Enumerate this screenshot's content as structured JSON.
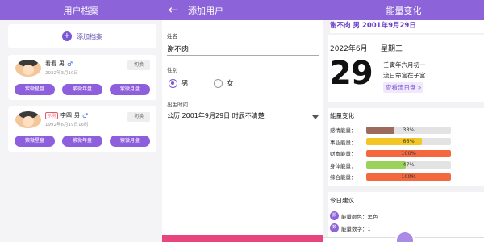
{
  "screen1": {
    "title": "用户档案",
    "add_label": "添加档案",
    "profiles": [
      {
        "name": "看看",
        "gender": "男",
        "gender_symbol": "♂",
        "tag": "",
        "date": "2022年3月10日",
        "switch": "切换",
        "buttons": [
          "紫微星盘",
          "紫微年盘",
          "紫微月盘"
        ]
      },
      {
        "name": "李四",
        "gender": "男",
        "gender_symbol": "♂",
        "tag": "示例",
        "date": "1992年6月19日16时",
        "switch": "切换",
        "buttons": [
          "紫微星盘",
          "紫微年盘",
          "紫微月盘"
        ]
      }
    ]
  },
  "screen2": {
    "title": "添加用户",
    "back_icon": "←",
    "name_label": "姓名",
    "name_value": "谢不肉",
    "gender_label": "性别",
    "gender_options": [
      "男",
      "女"
    ],
    "gender_selected": "男",
    "birth_label": "出生时间",
    "birth_value": "公历 2001年9月29日 时辰不清楚"
  },
  "screen3": {
    "title": "能量变化",
    "header_name": "谢不肉 男 2001年9月29日",
    "year_month": "2022年6月",
    "weekday": "星期三",
    "day": "29",
    "lunar_line1": "壬寅年六月初一",
    "lunar_line2": "流日命宫在子宫",
    "see_flow": "查看流日盘 »",
    "energy_title": "能量变化",
    "energy": [
      {
        "label": "感情能量：",
        "value": 33,
        "text": "33%",
        "color": "#9b6b5e"
      },
      {
        "label": "事业能量：",
        "value": 66,
        "text": "66%",
        "color": "#f3c623"
      },
      {
        "label": "财富能量：",
        "value": 100,
        "text": "100%",
        "color": "#f3683f"
      },
      {
        "label": "身体能量：",
        "value": 47,
        "text": "47%",
        "color": "#9bd35a"
      },
      {
        "label": "综合能量：",
        "value": 100,
        "text": "100%",
        "color": "#f3683f"
      }
    ],
    "advice_title": "今日建议",
    "advice": [
      {
        "icon": "颜",
        "text": "能量颜色：黑色"
      },
      {
        "icon": "数",
        "text": "能量数字：1"
      }
    ]
  }
}
